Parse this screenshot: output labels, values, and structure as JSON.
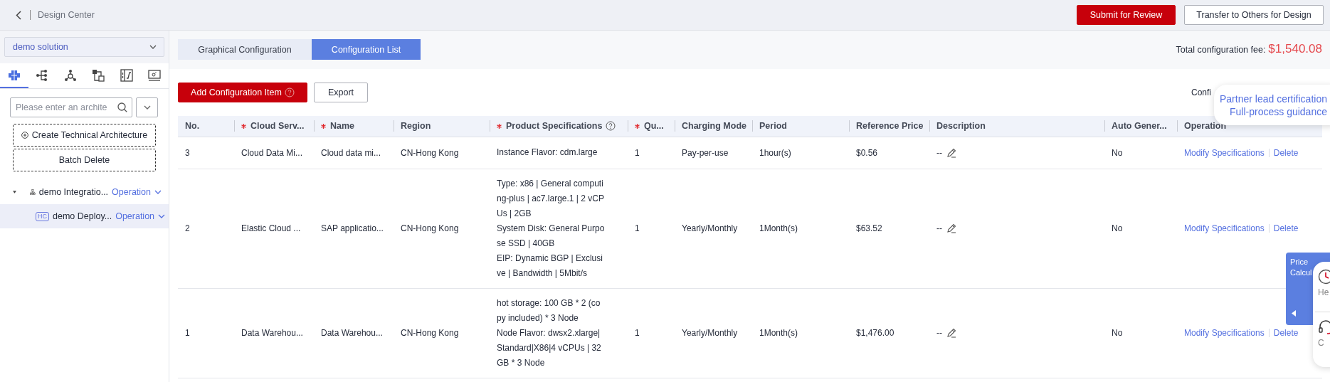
{
  "header": {
    "title": "Design Center",
    "buttons": [
      {
        "label": "Submit for Review",
        "kind": "primary"
      },
      {
        "label": "Transfer to Others for Design",
        "kind": "secondary"
      }
    ]
  },
  "sidebar": {
    "solution": "demo solution",
    "icon_tabs": [
      {
        "kind": "grid",
        "selected": true
      },
      {
        "kind": "branch",
        "selected": false
      },
      {
        "kind": "hub",
        "selected": false
      },
      {
        "kind": "flow",
        "selected": false
      },
      {
        "kind": "panel",
        "selected": false
      },
      {
        "kind": "screen",
        "selected": false
      }
    ],
    "search": {
      "placeholder": "Please enter an archite"
    },
    "actions": [
      {
        "label": "Create Technical Architecture",
        "kind": "create"
      },
      {
        "label": "Batch Delete",
        "kind": "plain"
      }
    ],
    "tree": [
      {
        "label": "demo Integratio...",
        "kind": "org",
        "action": "Operation",
        "expanded": true,
        "selected": false,
        "children": [
          {
            "label": "demo Deploy...",
            "kind": "deploy",
            "badge": "HC",
            "action": "Operation",
            "selected": true
          }
        ]
      }
    ]
  },
  "tabs": [
    {
      "label": "Graphical Configuration",
      "selected": false
    },
    {
      "label": "Configuration List",
      "selected": true
    }
  ],
  "total": {
    "label": "Total configuration fee:",
    "value": "$1,540.08"
  },
  "toolbar": {
    "buttons": [
      {
        "label": "Add Configuration Item",
        "kind": "primary",
        "help": true
      },
      {
        "label": "Export",
        "kind": "secondary",
        "help": false
      }
    ],
    "partial_text": "Confi"
  },
  "table": {
    "columns": [
      {
        "label": "No.",
        "required": false
      },
      {
        "label": "Cloud Serv...",
        "required": true
      },
      {
        "label": "Name",
        "required": true
      },
      {
        "label": "Region",
        "required": false
      },
      {
        "label": "Product Specifications",
        "required": true,
        "help": true
      },
      {
        "label": "Qu...",
        "required": true
      },
      {
        "label": "Charging Mode",
        "required": false
      },
      {
        "label": "Period",
        "required": false
      },
      {
        "label": "Reference Price",
        "required": false
      },
      {
        "label": "Description",
        "required": false
      },
      {
        "label": "Auto Gener...",
        "required": false
      },
      {
        "label": "Operation",
        "required": false
      }
    ],
    "rows": [
      {
        "no": "3",
        "cloud_service": "Cloud Data Mi...",
        "name": "Cloud data mi...",
        "region": "CN-Hong Kong",
        "specifications": [
          "Instance Flavor: cdm.large"
        ],
        "quantity": "1",
        "charging_mode": "Pay-per-use",
        "period": "1hour(s)",
        "reference_price": "$0.56",
        "description": "--",
        "auto_generated": "No",
        "operations": [
          "Modify Specifications",
          "Delete"
        ]
      },
      {
        "no": "2",
        "cloud_service": "Elastic Cloud ...",
        "name": "SAP applicatio...",
        "region": "CN-Hong Kong",
        "specifications": [
          "Type: x86 | General computing-plus | ac7.large.1 | 2 vCPUs | 2GB",
          "System Disk: General Purpose SSD | 40GB",
          "EIP: Dynamic BGP | Exclusive | Bandwidth | 5Mbit/s"
        ],
        "quantity": "1",
        "charging_mode": "Yearly/Monthly",
        "period": "1Month(s)",
        "reference_price": "$63.52",
        "description": "--",
        "auto_generated": "No",
        "operations": [
          "Modify Specifications",
          "Delete"
        ]
      },
      {
        "no": "1",
        "cloud_service": "Data Warehou...",
        "name": "Data Warehou...",
        "region": "CN-Hong Kong",
        "specifications": [
          "hot storage: 100 GB * 2 (copy included) * 3 Node",
          "Node Flavor: dwsx2.xlarge|Standard|X86|4 vCPUs | 32 GB * 3 Node"
        ],
        "quantity": "1",
        "charging_mode": "Yearly/Monthly",
        "period": "1Month(s)",
        "reference_price": "$1,476.00",
        "description": "--",
        "auto_generated": "No",
        "operations": [
          "Modify Specifications",
          "Delete"
        ]
      }
    ]
  },
  "guide_bubble": {
    "lines": [
      "Partner lead certification",
      "Full-process guidance"
    ]
  },
  "price_panel": {
    "title": "Price Calcul"
  },
  "help_panel": {
    "items": [
      {
        "kind": "help",
        "label": "He"
      },
      {
        "kind": "service",
        "label": "C"
      }
    ]
  }
}
